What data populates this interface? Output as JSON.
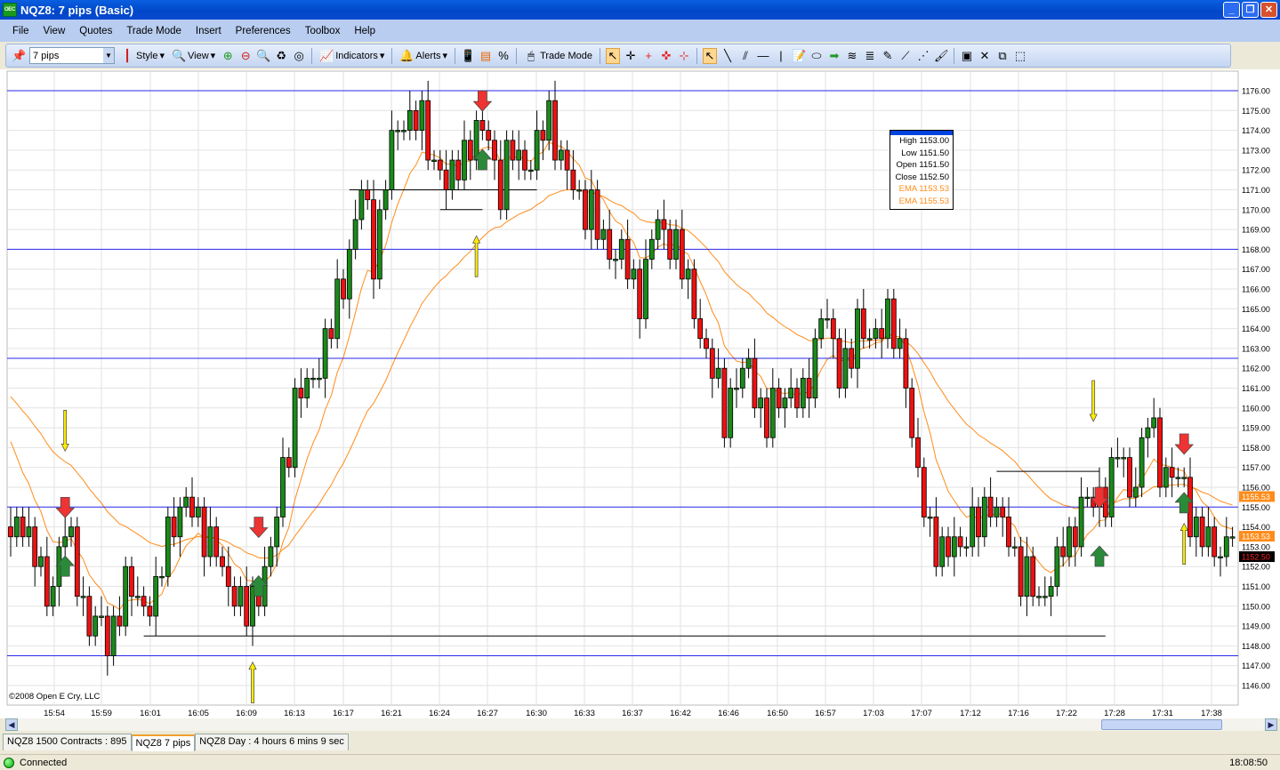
{
  "window": {
    "title": "NQZ8: 7 pips (Basic)",
    "icon_text": "OEC"
  },
  "menu": [
    "File",
    "View",
    "Quotes",
    "Trade Mode",
    "Insert",
    "Preferences",
    "Toolbox",
    "Help"
  ],
  "toolbar": {
    "interval": "7 pips",
    "style": "Style",
    "view": "View",
    "indicators": "Indicators",
    "alerts": "Alerts",
    "trade_mode": "Trade Mode"
  },
  "databox": {
    "high": "High  1153.00",
    "low": "Low  1151.50",
    "open": "Open  1151.50",
    "close": "Close  1152.50",
    "ema1": "EMA  1153.53",
    "ema2": "EMA  1155.53"
  },
  "copyright": "©2008 Open E Cry, LLC",
  "tabs": [
    "NQZ8 1500 Contracts : 895",
    "NQZ8 7 pips",
    "NQZ8 Day : 4 hours 6 mins 9 sec"
  ],
  "status": {
    "text": "Connected",
    "time": "18:08:50"
  },
  "colors": {
    "up": "#1a8a1a",
    "down": "#ee1111",
    "ema": "#ff8c1a",
    "level": "#2a2aee"
  },
  "chart_data": {
    "type": "candlestick",
    "symbol": "NQZ8",
    "ylim": [
      1145.5,
      1177
    ],
    "y_ticks": [
      "1176.00",
      "1175.00",
      "1174.00",
      "1173.00",
      "1172.00",
      "1171.00",
      "1170.00",
      "1169.00",
      "1168.00",
      "1167.00",
      "1166.00",
      "1165.00",
      "1164.00",
      "1163.00",
      "1162.00",
      "1161.00",
      "1160.00",
      "1159.00",
      "1158.00",
      "1157.00",
      "1156.00",
      "1155.00",
      "1154.00",
      "1153.00",
      "1152.00",
      "1151.00",
      "1150.00",
      "1149.00",
      "1148.00",
      "1147.00",
      "1146.00"
    ],
    "x_ticks": [
      "15:54",
      "15:59",
      "16:01",
      "16:05",
      "16:09",
      "16:13",
      "16:17",
      "16:21",
      "16:24",
      "16:27",
      "16:30",
      "16:33",
      "16:37",
      "16:42",
      "16:46",
      "16:50",
      "16:57",
      "17:03",
      "17:07",
      "17:12",
      "17:16",
      "17:22",
      "17:28",
      "17:31",
      "17:38"
    ],
    "close_path": [
      [
        0,
        1153
      ],
      [
        2,
        1154.5
      ],
      [
        6,
        1150.5
      ],
      [
        9,
        1154
      ],
      [
        13,
        1149
      ],
      [
        16,
        1148.5
      ],
      [
        19,
        1151
      ],
      [
        24,
        1150
      ],
      [
        26,
        1154
      ],
      [
        30,
        1155
      ],
      [
        34,
        1152.5
      ],
      [
        39,
        1149.5
      ],
      [
        43,
        1152.5
      ],
      [
        45,
        1157
      ],
      [
        47,
        1160
      ],
      [
        50,
        1161.5
      ],
      [
        53,
        1164
      ],
      [
        56,
        1168
      ],
      [
        58,
        1171
      ],
      [
        60,
        1168
      ],
      [
        63,
        1173
      ],
      [
        65,
        1175
      ],
      [
        68,
        1174
      ],
      [
        71,
        1172
      ],
      [
        72,
        1171
      ],
      [
        75,
        1173
      ],
      [
        79,
        1174
      ],
      [
        81,
        1171
      ],
      [
        83,
        1173
      ],
      [
        86,
        1172
      ],
      [
        89,
        1175
      ],
      [
        91,
        1172
      ],
      [
        94,
        1171
      ],
      [
        97,
        1169
      ],
      [
        100,
        1168
      ],
      [
        104,
        1166
      ],
      [
        107,
        1169.5
      ],
      [
        110,
        1168
      ],
      [
        113,
        1165
      ],
      [
        116,
        1161.5
      ],
      [
        118,
        1160
      ],
      [
        122,
        1162
      ],
      [
        125,
        1159
      ],
      [
        128,
        1161
      ],
      [
        131,
        1160
      ],
      [
        134,
        1165
      ],
      [
        137,
        1162
      ],
      [
        140,
        1163.5
      ],
      [
        143,
        1164
      ],
      [
        146,
        1164
      ],
      [
        148,
        1162
      ],
      [
        149,
        1158
      ],
      [
        151,
        1155
      ],
      [
        154,
        1152.5
      ],
      [
        157,
        1153.5
      ],
      [
        160,
        1154
      ],
      [
        162,
        1155.5
      ],
      [
        165,
        1153
      ],
      [
        168,
        1151.5
      ],
      [
        170,
        1150
      ],
      [
        172,
        1152
      ],
      [
        175,
        1153
      ],
      [
        177,
        1155.5
      ],
      [
        180,
        1155
      ],
      [
        183,
        1158
      ],
      [
        185,
        1155.5
      ],
      [
        188,
        1159.5
      ],
      [
        190,
        1157
      ],
      [
        193,
        1156.5
      ],
      [
        196,
        1154
      ],
      [
        199,
        1152.5
      ],
      [
        202,
        1154
      ]
    ],
    "ema_periods": [
      9,
      34
    ],
    "ema_last": [
      1153.53,
      1155.53
    ],
    "last_close": "1152.50",
    "axis_tags": [
      {
        "label": "1155.53",
        "price": 1155.53,
        "kind": "ema"
      },
      {
        "label": "1153.53",
        "price": 1153.53,
        "kind": "ema"
      },
      {
        "label": "1152.50",
        "price": 1152.5,
        "kind": "last"
      }
    ],
    "horizontal_levels": [
      1176,
      1168,
      1162.5,
      1155,
      1147.5
    ],
    "trend_lines": [
      {
        "price": 1171,
        "from": 56,
        "to": 87
      },
      {
        "price": 1170,
        "from": 71,
        "to": 78
      },
      {
        "price": 1148.5,
        "from": 22,
        "to": 181
      },
      {
        "price": 1156.8,
        "from": 163,
        "to": 180
      }
    ],
    "signals": [
      {
        "type": "yellow-down",
        "idx": 9,
        "price": 1158
      },
      {
        "type": "red-down",
        "idx": 9,
        "price": 1155
      },
      {
        "type": "green-up",
        "idx": 9,
        "price": 1152
      },
      {
        "type": "yellow-up",
        "idx": 40,
        "price": 1147
      },
      {
        "type": "red-down",
        "idx": 41,
        "price": 1154
      },
      {
        "type": "green-up",
        "idx": 41,
        "price": 1151
      },
      {
        "type": "red-down",
        "idx": 78,
        "price": 1175.5
      },
      {
        "type": "green-up",
        "idx": 78,
        "price": 1172.5
      },
      {
        "type": "yellow-up",
        "idx": 77,
        "price": 1168.5
      },
      {
        "type": "yellow-down",
        "idx": 179,
        "price": 1159.5
      },
      {
        "type": "red-down",
        "idx": 180,
        "price": 1155.5
      },
      {
        "type": "green-up",
        "idx": 180,
        "price": 1152.5
      },
      {
        "type": "yellow-up",
        "idx": 194,
        "price": 1154
      },
      {
        "type": "red-down",
        "idx": 194,
        "price": 1158.2
      },
      {
        "type": "green-up",
        "idx": 194,
        "price": 1155.2
      }
    ]
  }
}
